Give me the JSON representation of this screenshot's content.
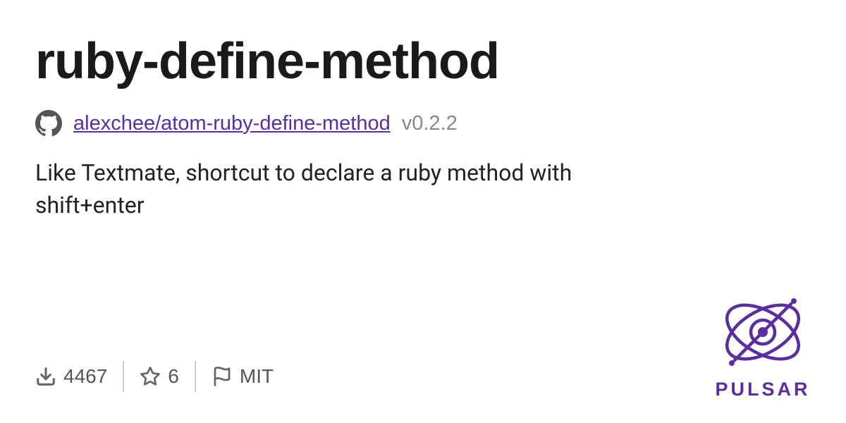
{
  "title": "ruby-define-method",
  "repo": {
    "path": "alexchee/atom-ruby-define-method",
    "version": "v0.2.2"
  },
  "description": "Like Textmate, shortcut to declare a ruby method with shift+enter",
  "stats": {
    "downloads": "4467",
    "stars": "6",
    "license": "MIT"
  },
  "brand": {
    "name": "PULSAR",
    "color": "#5b2e9f"
  }
}
